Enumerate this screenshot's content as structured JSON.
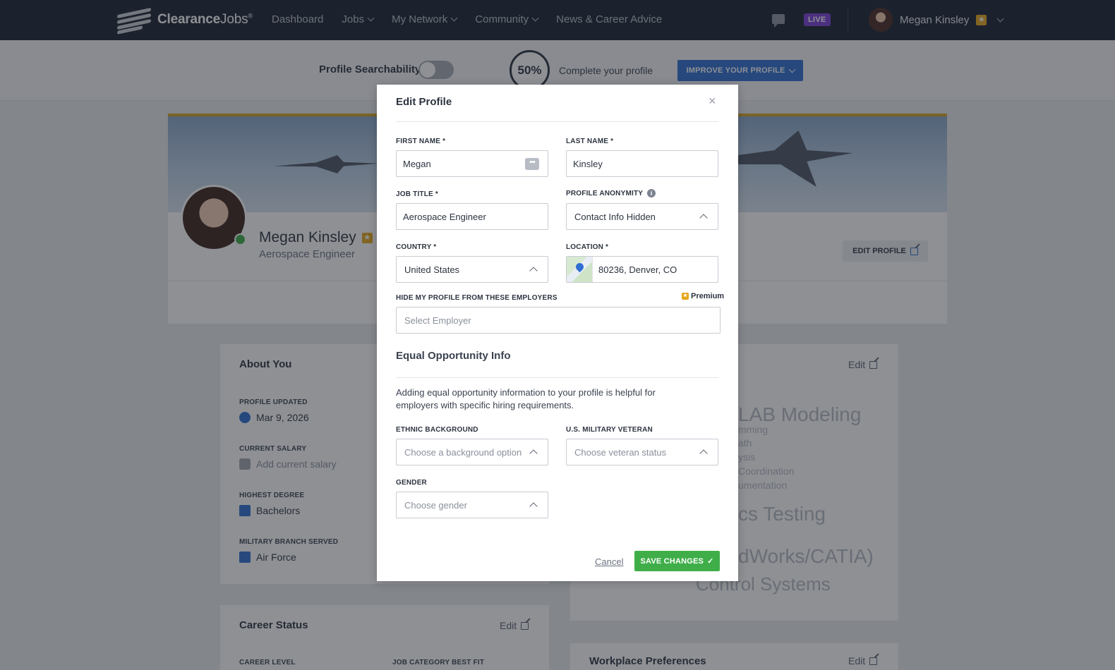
{
  "nav": {
    "logo_prefix": "Clearance",
    "logo_suffix": "Jobs",
    "logo_reg": "®",
    "items": [
      {
        "label": "Dashboard",
        "dropdown": false
      },
      {
        "label": "Jobs",
        "dropdown": true
      },
      {
        "label": "My Network",
        "dropdown": true
      },
      {
        "label": "Community",
        "dropdown": true
      },
      {
        "label": "News & Career Advice",
        "dropdown": false
      }
    ],
    "live_badge": "LIVE",
    "user_name": "Megan Kinsley",
    "star": "★",
    "chat_icon": "chat-icon"
  },
  "profile_bar": {
    "searchability_label": "Profile Searchability",
    "searchability_on": false,
    "completion": "50%",
    "complete_text": "Complete your profile",
    "improve_button": "IMPROVE YOUR PROFILE"
  },
  "background": {
    "name": "Megan Kinsley",
    "title": "Aerospace Engineer",
    "edit_profile": "EDIT PROFILE",
    "about": {
      "title": "About You",
      "fields": [
        {
          "label": "PROFILE UPDATED",
          "value": "Mar 9, 2026",
          "icon": "refresh-icon"
        },
        {
          "label": "CURRENT SALARY",
          "value": "Add current salary",
          "icon": "wallet-icon"
        },
        {
          "label": "HIGHEST DEGREE",
          "value": "Bachelors",
          "icon": "graduation-cap-icon"
        },
        {
          "label": "MILITARY BRANCH SERVED",
          "value": "Air Force",
          "icon": "building-icon"
        }
      ]
    },
    "skills": {
      "edit": "Edit",
      "visible_fragments": [
        "LAB Modeling",
        "mming",
        "ath",
        "ysis",
        "Coordination",
        "umentation",
        "cs Testing",
        "dWorks/CATIA)",
        "Control Systems"
      ]
    },
    "career_status": {
      "title": "Career Status",
      "edit": "Edit",
      "col1": "CAREER LEVEL",
      "col2": "JOB CATEGORY BEST FIT"
    },
    "workplace": {
      "title": "Workplace Preferences",
      "edit": "Edit"
    }
  },
  "modal": {
    "title": "Edit Profile",
    "close": "×",
    "first_name": {
      "label": "FIRST NAME *",
      "value": "Megan"
    },
    "last_name": {
      "label": "LAST NAME *",
      "value": "Kinsley"
    },
    "job_title": {
      "label": "JOB TITLE *",
      "value": "Aerospace Engineer"
    },
    "anonymity": {
      "label": "PROFILE ANONYMITY",
      "value": "Contact Info Hidden"
    },
    "country": {
      "label": "COUNTRY *",
      "value": "United States"
    },
    "location": {
      "label": "LOCATION *",
      "value": "80236, Denver, CO"
    },
    "hide_employers": {
      "label": "HIDE MY PROFILE FROM THESE EMPLOYERS",
      "placeholder": "Select Employer",
      "premium": "Premium"
    },
    "eo_title": "Equal Opportunity Info",
    "eo_text": "Adding equal opportunity information to your profile is helpful for employers with specific hiring requirements.",
    "ethnic": {
      "label": "ETHNIC BACKGROUND",
      "placeholder": "Choose a background option"
    },
    "veteran": {
      "label": "U.S. MILITARY VETERAN",
      "placeholder": "Choose veteran status"
    },
    "gender": {
      "label": "GENDER",
      "placeholder": "Choose gender"
    },
    "cancel": "Cancel",
    "save": "SAVE CHANGES",
    "save_check": "✓"
  },
  "colors": {
    "nav_bg": "#1b2230",
    "primary_blue": "#2f6fd0",
    "save_green": "#3fae49",
    "premium_gold": "#e6a61c",
    "live_purple": "#7b3fd6"
  }
}
